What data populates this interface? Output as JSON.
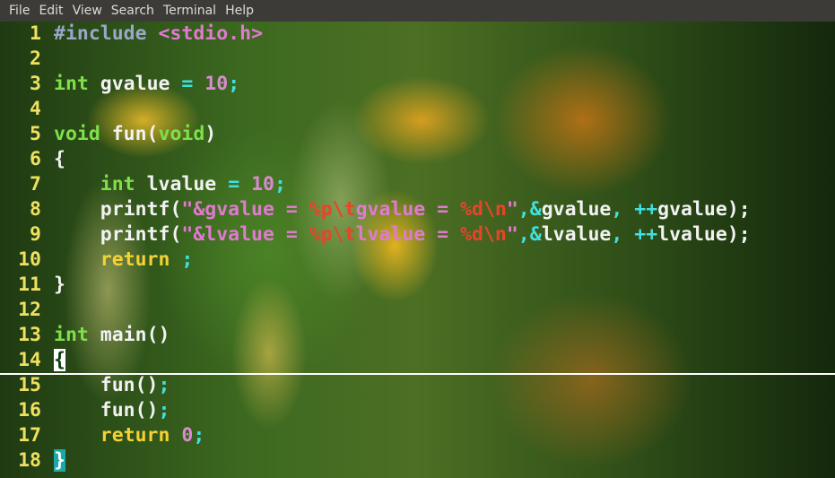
{
  "menubar": {
    "items": [
      "File",
      "Edit",
      "View",
      "Search",
      "Terminal",
      "Help"
    ]
  },
  "editor": {
    "lines": [
      {
        "num": "1",
        "segments": [
          {
            "t": "#include",
            "c": "pp"
          },
          {
            "t": " ",
            "c": "id"
          },
          {
            "t": "<stdio.h>",
            "c": "str"
          }
        ]
      },
      {
        "num": "2",
        "segments": []
      },
      {
        "num": "3",
        "segments": [
          {
            "t": "int",
            "c": "kw"
          },
          {
            "t": " gvalue ",
            "c": "id"
          },
          {
            "t": "=",
            "c": "sym"
          },
          {
            "t": " 10",
            "c": "num"
          },
          {
            "t": ";",
            "c": "sym"
          }
        ]
      },
      {
        "num": "4",
        "segments": []
      },
      {
        "num": "5",
        "segments": [
          {
            "t": "void",
            "c": "kw"
          },
          {
            "t": " fun(",
            "c": "id"
          },
          {
            "t": "void",
            "c": "kw"
          },
          {
            "t": ")",
            "c": "id"
          }
        ]
      },
      {
        "num": "6",
        "segments": [
          {
            "t": "{",
            "c": "id"
          }
        ]
      },
      {
        "num": "7",
        "segments": [
          {
            "t": "    ",
            "c": "id"
          },
          {
            "t": "int",
            "c": "kw"
          },
          {
            "t": " lvalue ",
            "c": "id"
          },
          {
            "t": "=",
            "c": "sym"
          },
          {
            "t": " 10",
            "c": "num"
          },
          {
            "t": ";",
            "c": "sym"
          }
        ]
      },
      {
        "num": "8",
        "segments": [
          {
            "t": "    printf(",
            "c": "id"
          },
          {
            "t": "\"&gvalue = ",
            "c": "str"
          },
          {
            "t": "%p\\t",
            "c": "esc"
          },
          {
            "t": "gvalue = ",
            "c": "str"
          },
          {
            "t": "%d\\n",
            "c": "esc"
          },
          {
            "t": "\"",
            "c": "str"
          },
          {
            "t": ",",
            "c": "sym"
          },
          {
            "t": "&",
            "c": "sym"
          },
          {
            "t": "gvalue",
            "c": "id"
          },
          {
            "t": ", ",
            "c": "sym"
          },
          {
            "t": "++",
            "c": "sym"
          },
          {
            "t": "gvalue);",
            "c": "id"
          }
        ]
      },
      {
        "num": "9",
        "segments": [
          {
            "t": "    printf(",
            "c": "id"
          },
          {
            "t": "\"&lvalue = ",
            "c": "str"
          },
          {
            "t": "%p\\t",
            "c": "esc"
          },
          {
            "t": "lvalue = ",
            "c": "str"
          },
          {
            "t": "%d\\n",
            "c": "esc"
          },
          {
            "t": "\"",
            "c": "str"
          },
          {
            "t": ",",
            "c": "sym"
          },
          {
            "t": "&",
            "c": "sym"
          },
          {
            "t": "lvalue",
            "c": "id"
          },
          {
            "t": ", ",
            "c": "sym"
          },
          {
            "t": "++",
            "c": "sym"
          },
          {
            "t": "lvalue);",
            "c": "id"
          }
        ]
      },
      {
        "num": "10",
        "segments": [
          {
            "t": "    ",
            "c": "id"
          },
          {
            "t": "return",
            "c": "ret"
          },
          {
            "t": " ;",
            "c": "sym"
          }
        ]
      },
      {
        "num": "11",
        "segments": [
          {
            "t": "}",
            "c": "id"
          }
        ]
      },
      {
        "num": "12",
        "segments": []
      },
      {
        "num": "13",
        "segments": [
          {
            "t": "int",
            "c": "kw"
          },
          {
            "t": " main()",
            "c": "id"
          }
        ]
      },
      {
        "num": "14",
        "segments": [
          {
            "t": "{",
            "c": "cursor-block"
          }
        ]
      },
      {
        "num": "15",
        "segments": [
          {
            "t": "    fun()",
            "c": "id"
          },
          {
            "t": ";",
            "c": "sym"
          }
        ]
      },
      {
        "num": "16",
        "segments": [
          {
            "t": "    fun()",
            "c": "id"
          },
          {
            "t": ";",
            "c": "sym"
          }
        ]
      },
      {
        "num": "17",
        "segments": [
          {
            "t": "    ",
            "c": "id"
          },
          {
            "t": "return",
            "c": "ret"
          },
          {
            "t": " 0",
            "c": "num"
          },
          {
            "t": ";",
            "c": "sym"
          }
        ]
      },
      {
        "num": "18",
        "segments": [
          {
            "t": "}",
            "c": "cursor-teal"
          }
        ]
      }
    ],
    "cursor_line": "14"
  },
  "colors": {
    "menubar_bg": "#3c3b37",
    "line_number": "#f0e060",
    "keyword": "#7fe04a",
    "escape": "#e8442a",
    "symbol": "#40e0e0"
  }
}
